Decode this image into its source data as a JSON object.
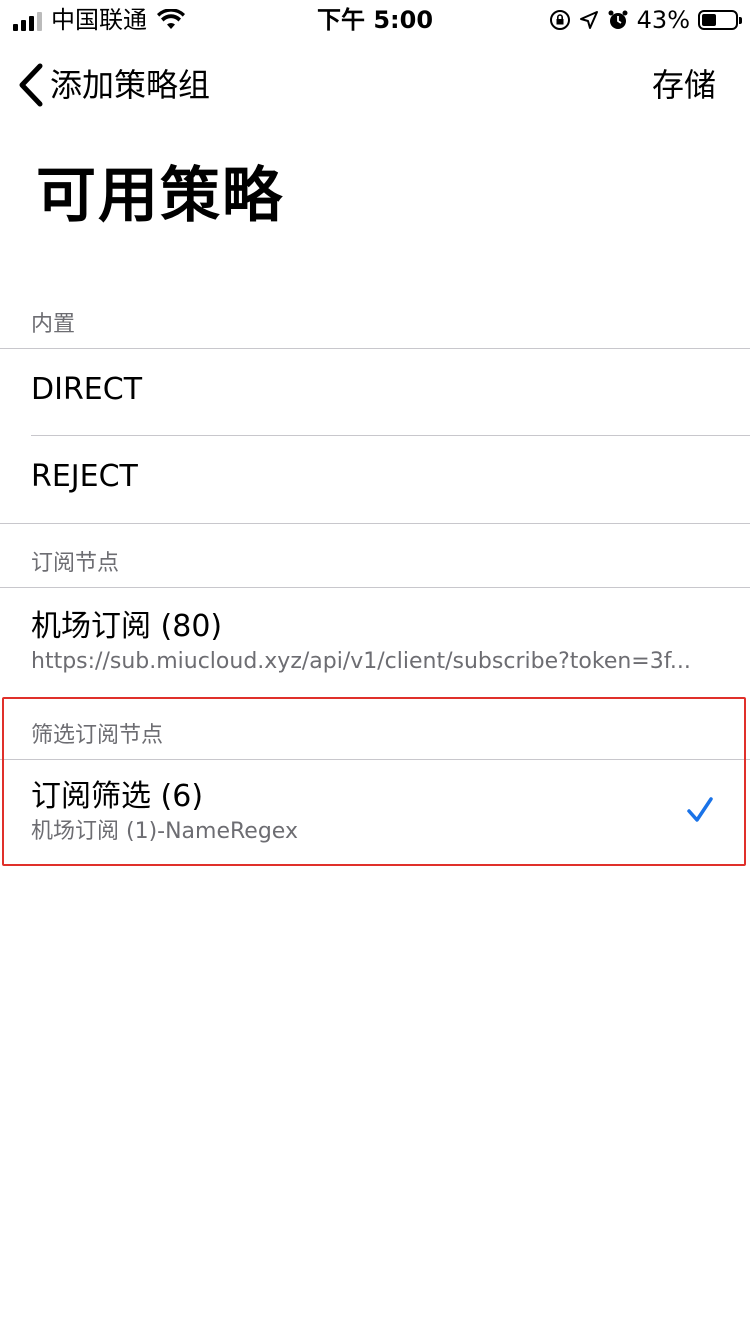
{
  "status_bar": {
    "carrier": "中国联通",
    "time": "下午 5:00",
    "battery_percent": "43%",
    "battery_level": 0.43,
    "icons": [
      "signal-icon",
      "wifi-icon",
      "orientation-lock-icon",
      "location-icon",
      "alarm-icon",
      "battery-icon"
    ]
  },
  "nav": {
    "back_label": "添加策略组",
    "save_label": "存储"
  },
  "page_title": "可用策略",
  "sections": {
    "builtin": {
      "header": "内置",
      "items": [
        {
          "title": "DIRECT"
        },
        {
          "title": "REJECT"
        }
      ]
    },
    "subscription": {
      "header": "订阅节点",
      "items": [
        {
          "title": "机场订阅 (80)",
          "subtitle": "https://sub.miucloud.xyz/api/v1/client/subscribe?token=3f..."
        }
      ]
    },
    "filter": {
      "header": "筛选订阅节点",
      "items": [
        {
          "title": "订阅筛选 (6)",
          "subtitle": "机场订阅 (1)-NameRegex",
          "selected": true
        }
      ]
    }
  },
  "colors": {
    "accent": "#1a73e8",
    "highlight_border": "#e0302a",
    "separator": "#c8c7cc",
    "secondary_text": "#6d6d72"
  }
}
